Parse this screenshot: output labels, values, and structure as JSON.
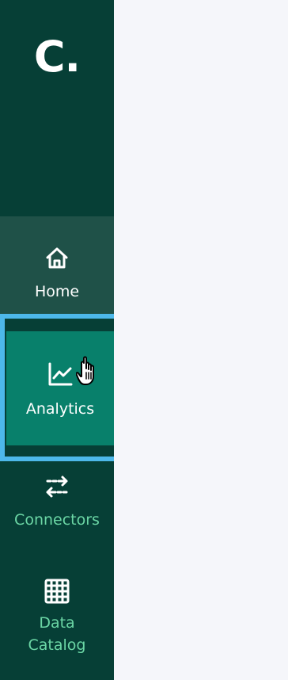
{
  "sidebar": {
    "logo": "C.",
    "items": [
      {
        "label": "Home",
        "icon": "home-icon",
        "state": "hover"
      },
      {
        "label": "Analytics",
        "icon": "analytics-icon",
        "state": "selected"
      },
      {
        "label": "Connectors",
        "icon": "connectors-icon",
        "state": "default"
      },
      {
        "label": "Data Catalog",
        "icon": "grid-icon",
        "state": "default"
      }
    ]
  },
  "colors": {
    "sidebar_bg": "#063F36",
    "hover_bg": "#1F5148",
    "selected_bg": "#08806B",
    "highlight_border": "#4DB8EA",
    "inactive_text": "#6BD6A5",
    "active_text": "#FFFFFF",
    "main_bg": "#F5F6FA"
  }
}
